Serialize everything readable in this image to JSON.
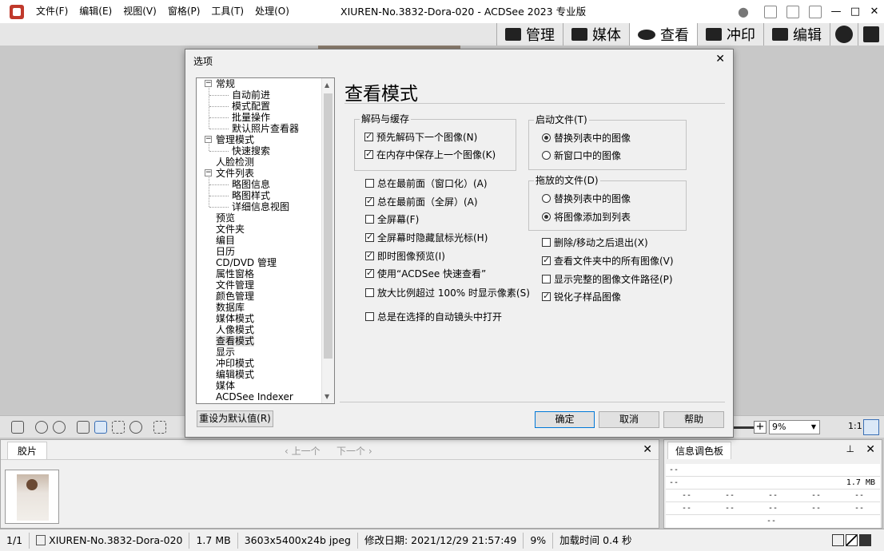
{
  "window": {
    "title": "XIUREN-No.3832-Dora-020 - ACDSee 2023 专业版",
    "menu": [
      "文件(F)",
      "编辑(E)",
      "视图(V)",
      "窗格(P)",
      "工具(T)",
      "处理(O)"
    ],
    "controls": {
      "minimize": "—",
      "maximize": "□",
      "close": "✕"
    }
  },
  "modes": [
    {
      "label": "管理",
      "icon": "grid-icon"
    },
    {
      "label": "媒体",
      "icon": "media-icon"
    },
    {
      "label": "查看",
      "icon": "eye-icon",
      "active": true
    },
    {
      "label": "冲印",
      "icon": "develop-icon"
    },
    {
      "label": "编辑",
      "icon": "edit-icon"
    }
  ],
  "toolbar": {
    "zoom_value": "9%",
    "ratio_label": "1:1"
  },
  "filmstrip": {
    "tab": "胶片",
    "prev": "上一个",
    "next": "下一个",
    "close": "✕"
  },
  "info_palette": {
    "tab": "信息调色板",
    "pin": "✕",
    "close": "✕",
    "rows": [
      {
        "cells": [
          "--"
        ]
      },
      {
        "cells": [
          "--",
          "1.7 MB"
        ]
      },
      {
        "cells": [
          "--",
          "--",
          "--",
          "--",
          "--"
        ]
      },
      {
        "cells": [
          "--",
          "--",
          "--",
          "--",
          "--"
        ]
      },
      {
        "cells": [
          "--"
        ]
      }
    ]
  },
  "status": {
    "index": "1/1",
    "filename": "XIUREN-No.3832-Dora-020",
    "size": "1.7 MB",
    "dims": "3603x5400x24b jpeg",
    "modified": "修改日期: 2021/12/29 21:57:49",
    "zoom": "9%",
    "load_time": "加载时间 0.4 秒"
  },
  "dialog": {
    "title": "选项",
    "page_title": "查看模式",
    "tree": [
      {
        "label": "常规",
        "level": 0,
        "expander": "−"
      },
      {
        "label": "自动前进",
        "level": 1
      },
      {
        "label": "模式配置",
        "level": 1
      },
      {
        "label": "批量操作",
        "level": 1
      },
      {
        "label": "默认照片查看器",
        "level": 1
      },
      {
        "label": "管理模式",
        "level": 0,
        "expander": "−"
      },
      {
        "label": "快速搜索",
        "level": 1
      },
      {
        "label": "人脸检测",
        "level": 0
      },
      {
        "label": "文件列表",
        "level": 0,
        "expander": "−"
      },
      {
        "label": "略图信息",
        "level": 1
      },
      {
        "label": "略图样式",
        "level": 1
      },
      {
        "label": "详细信息视图",
        "level": 1
      },
      {
        "label": "预览",
        "level": 0
      },
      {
        "label": "文件夹",
        "level": 0
      },
      {
        "label": "编目",
        "level": 0
      },
      {
        "label": "日历",
        "level": 0
      },
      {
        "label": "CD/DVD 管理",
        "level": 0
      },
      {
        "label": "属性窗格",
        "level": 0
      },
      {
        "label": "文件管理",
        "level": 0
      },
      {
        "label": "颜色管理",
        "level": 0
      },
      {
        "label": "数据库",
        "level": 0
      },
      {
        "label": "媒体模式",
        "level": 0
      },
      {
        "label": "人像模式",
        "level": 0
      },
      {
        "label": "查看模式",
        "level": 0,
        "selected": true
      },
      {
        "label": "显示",
        "level": 0
      },
      {
        "label": "冲印模式",
        "level": 0
      },
      {
        "label": "编辑模式",
        "level": 0
      },
      {
        "label": "媒体",
        "level": 0
      },
      {
        "label": "ACDSee Indexer",
        "level": 0
      }
    ],
    "groups": {
      "decode": {
        "label": "解码与缓存",
        "options": [
          {
            "label": "预先解码下一个图像(N)",
            "checked": true
          },
          {
            "label": "在内存中保存上一个图像(K)",
            "checked": true
          }
        ]
      },
      "startup": {
        "label": "启动文件(T)",
        "options": [
          {
            "label": "替换列表中的图像",
            "checked": true
          },
          {
            "label": "新窗口中的图像",
            "checked": false
          }
        ]
      },
      "dropped": {
        "label": "拖放的文件(D)",
        "options": [
          {
            "label": "替换列表中的图像",
            "checked": false
          },
          {
            "label": "将图像添加到列表",
            "checked": true
          }
        ]
      }
    },
    "left_options": [
      {
        "label": "总在最前面（窗口化）(A)",
        "checked": false
      },
      {
        "label": "总在最前面（全屏）(A)",
        "checked": true
      },
      {
        "label": "全屏幕(F)",
        "checked": false
      },
      {
        "label": "全屏幕时隐藏鼠标光标(H)",
        "checked": true
      },
      {
        "label": "即时图像预览(I)",
        "checked": true
      },
      {
        "label": "使用“ACDSee 快速查看”",
        "checked": true
      },
      {
        "label": "放大比例超过 100% 时显示像素(S)",
        "checked": false
      },
      {
        "label": "总是在选择的自动镜头中打开",
        "checked": false
      }
    ],
    "right_options": [
      {
        "label": "删除/移动之后退出(X)",
        "checked": false
      },
      {
        "label": "查看文件夹中的所有图像(V)",
        "checked": true
      },
      {
        "label": "显示完整的图像文件路径(P)",
        "checked": false
      },
      {
        "label": "锐化子样品图像",
        "checked": true
      }
    ],
    "buttons": {
      "reset": "重设为默认值(R)",
      "ok": "确定",
      "cancel": "取消",
      "help": "帮助"
    },
    "close": "✕"
  }
}
